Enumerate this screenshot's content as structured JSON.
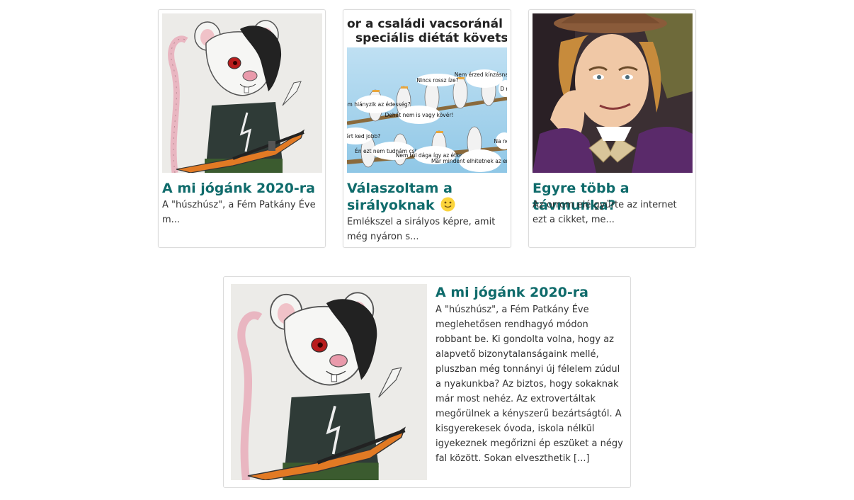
{
  "related": [
    {
      "title": "A mi jógánk 2020-ra",
      "excerpt": "A \"húszhúsz\", a Fém Patkány Éve m...",
      "image": "rat-rocker-guitar-illustration"
    },
    {
      "title": "Válaszoltam a sirályoknak",
      "emoji": "🙂",
      "excerpt": "Emlékszel a sirályos képre, amit még nyáron s...",
      "image": "seagulls-meme",
      "image_text": {
        "line1": "or a családi vacsoránál kö",
        "line2": "speciális diétát követsz:",
        "bubbles": [
          "Nincs rossz íze?",
          "Nem érzed kínzásnak?",
          "Nem hiányzik az édesség?",
          "Dehát nem is vagy kövér!",
          "tól miért ked jobb?",
          "Én ezt nem tudnám csinálni!",
          "Nem túl dága így az étkezés?",
          "Már mindent elhitetnek az emberrel!",
          "Na nem",
          "D m"
        ]
      }
    },
    {
      "title": "Egyre több a távmunka?",
      "excerpt": "Az orrom elé gyűrte az internet ezt a cikket, me...",
      "image": "condescending-wonka-meme"
    }
  ],
  "featured": {
    "title": "A mi jógánk 2020-ra",
    "excerpt": "A \"húszhúsz\", a Fém Patkány Éve meglehetősen rendhagyó módon robbant be. Ki gondolta volna, hogy az alapvető bizonytalanságaink mellé, pluszban még tonnányi új félelem zúdul a nyakunkba? Az biztos, hogy sokaknak már most nehéz. Az extrovertáltak megőrülnek a kényszerű bezártságtól. A kisgyerekesek óvoda, iskola nélkül igyekeznek megőrizni ép eszüket a négy fal között. Sokan elveszthetik [...]",
    "image": "rat-rocker-guitar-illustration"
  },
  "colors": {
    "title": "#0f6b6b",
    "border": "#dcdcdc",
    "text": "#333333"
  }
}
